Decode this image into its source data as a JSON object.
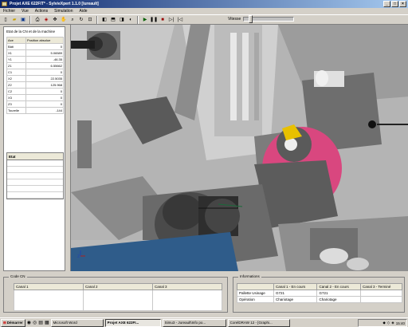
{
  "window": {
    "title": "Projet AXE 622FIT* - SylvieXpert 1.1.0 [lureault]"
  },
  "menu": [
    "Fichier",
    "Vue",
    "Actions",
    "Simulation",
    "Aide"
  ],
  "toolbar": {
    "icons": [
      "new-file-icon",
      "open-folder-icon",
      "save-icon",
      "print-icon",
      "machine-icon",
      "move-icon",
      "pan-icon",
      "zoom-icon",
      "rotate-icon",
      "fit-icon",
      "view-front-icon",
      "view-top-icon",
      "view-side-icon",
      "shade-icon",
      "play-icon",
      "pause-icon",
      "stop-icon",
      "step-icon",
      "rewind-icon"
    ],
    "speed_label": "Vitesse",
    "speed_value": 0.1
  },
  "left_panel": {
    "title": "Etat de la CN et de la machine",
    "columns": [
      "Axe",
      "Position absolue"
    ],
    "rows": [
      [
        "Bâti",
        "0"
      ],
      [
        "X1",
        "5.06589"
      ],
      [
        "Y1",
        "-46.35"
      ],
      [
        "Z1",
        "6.55662"
      ],
      [
        "C1",
        "0"
      ],
      [
        "X2",
        "22.5035"
      ],
      [
        "Z2",
        "125.968"
      ],
      [
        "C2",
        "0"
      ],
      [
        "X3",
        "0"
      ],
      [
        "Z3",
        "0"
      ],
      [
        "Tourelle",
        "-144"
      ]
    ],
    "etat_title": "Etat"
  },
  "code_cn": {
    "title": "Code CN",
    "columns": [
      "Canal 1",
      "Canal 2",
      "Canal 3"
    ]
  },
  "informations": {
    "title": "Informations",
    "columns": [
      "",
      "Canal 1 - En cours",
      "Canal 2 - En cours",
      "Canal 3 - Terminé"
    ],
    "rows": [
      [
        "Pallette Usinage",
        "G721",
        "G721",
        ""
      ],
      [
        "Opération",
        "Chariotage",
        "Chariotage",
        ""
      ]
    ]
  },
  "taskbar": {
    "start": "Démarrer",
    "tasks": [
      "Microsoft Word",
      "Projet AXE 622FI...",
      "Simu3 - Jureault\\Info po...",
      "CorelDRAW 12 - [Graphi..."
    ],
    "active_index": 1,
    "clock": "15:40"
  },
  "colors": {
    "title_start": "#0a246a",
    "title_end": "#a6caf0",
    "chrome": "#d4d0c8",
    "viewport_bg": "#b4b4b4",
    "part_pink": "#d9477f",
    "base_blue": "#2f5c8a"
  }
}
